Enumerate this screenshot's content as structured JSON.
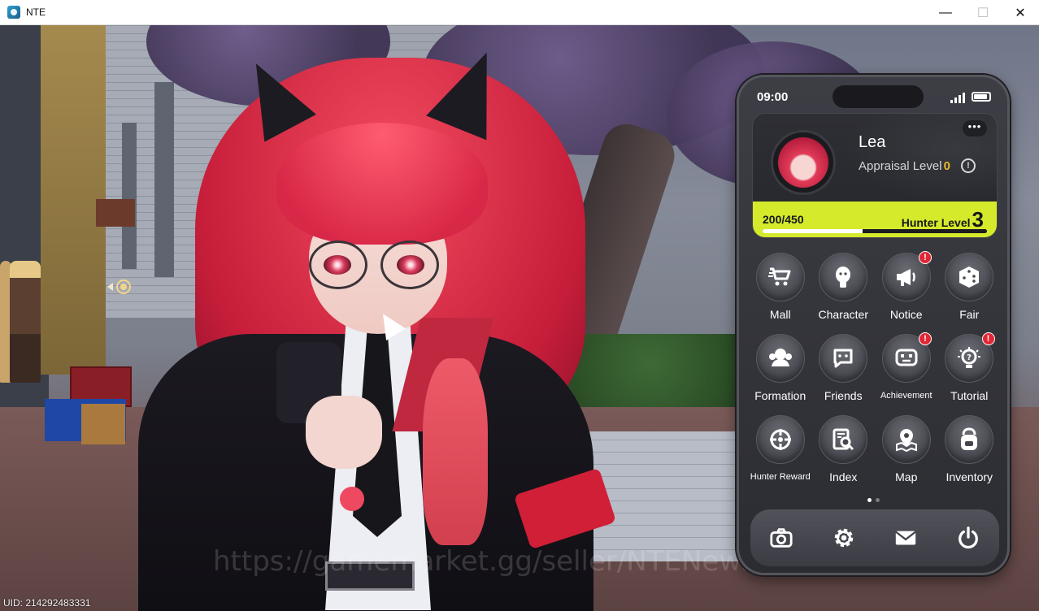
{
  "window": {
    "title": "NTE",
    "minimize_glyph": "—",
    "maximize_glyph": "☐",
    "close_glyph": "✕"
  },
  "scene": {
    "uid_text": "UID: 214292483331",
    "watermark_text": "https://gamemarket.gg/seller/NTENews"
  },
  "phone": {
    "time": "09:00",
    "more_glyph": "•••",
    "profile": {
      "name": "Lea",
      "appraisal_label": "Appraisal Level",
      "appraisal_level": "0",
      "xp_text": "200/450",
      "xp_fraction": 0.444,
      "hunter_label": "Hunter Level",
      "hunter_level": "3"
    },
    "apps": [
      {
        "label": "Mall",
        "icon": "cart-icon",
        "badge": ""
      },
      {
        "label": "Character",
        "icon": "character-icon",
        "badge": ""
      },
      {
        "label": "Notice",
        "icon": "megaphone-icon",
        "badge": "!"
      },
      {
        "label": "Fair",
        "icon": "dice-icon",
        "badge": ""
      },
      {
        "label": "Formation",
        "icon": "formation-icon",
        "badge": ""
      },
      {
        "label": "Friends",
        "icon": "chat-icon",
        "badge": ""
      },
      {
        "label": "Achievement",
        "icon": "achievement-icon",
        "badge": "!"
      },
      {
        "label": "Tutorial",
        "icon": "lightbulb-icon",
        "badge": "!"
      },
      {
        "label": "Hunter Reward",
        "icon": "crosshair-icon",
        "badge": ""
      },
      {
        "label": "Index",
        "icon": "index-search-icon",
        "badge": ""
      },
      {
        "label": "Map",
        "icon": "map-pin-icon",
        "badge": ""
      },
      {
        "label": "Inventory",
        "icon": "backpack-icon",
        "badge": ""
      }
    ],
    "pager": {
      "pages": 2,
      "active": 0
    },
    "dock": [
      "camera-icon",
      "settings-gear-icon",
      "mail-icon",
      "power-icon"
    ]
  },
  "colors": {
    "level_bar": "#d5ea2b",
    "badge": "#e32634",
    "appraisal_value": "#e9b92c"
  }
}
